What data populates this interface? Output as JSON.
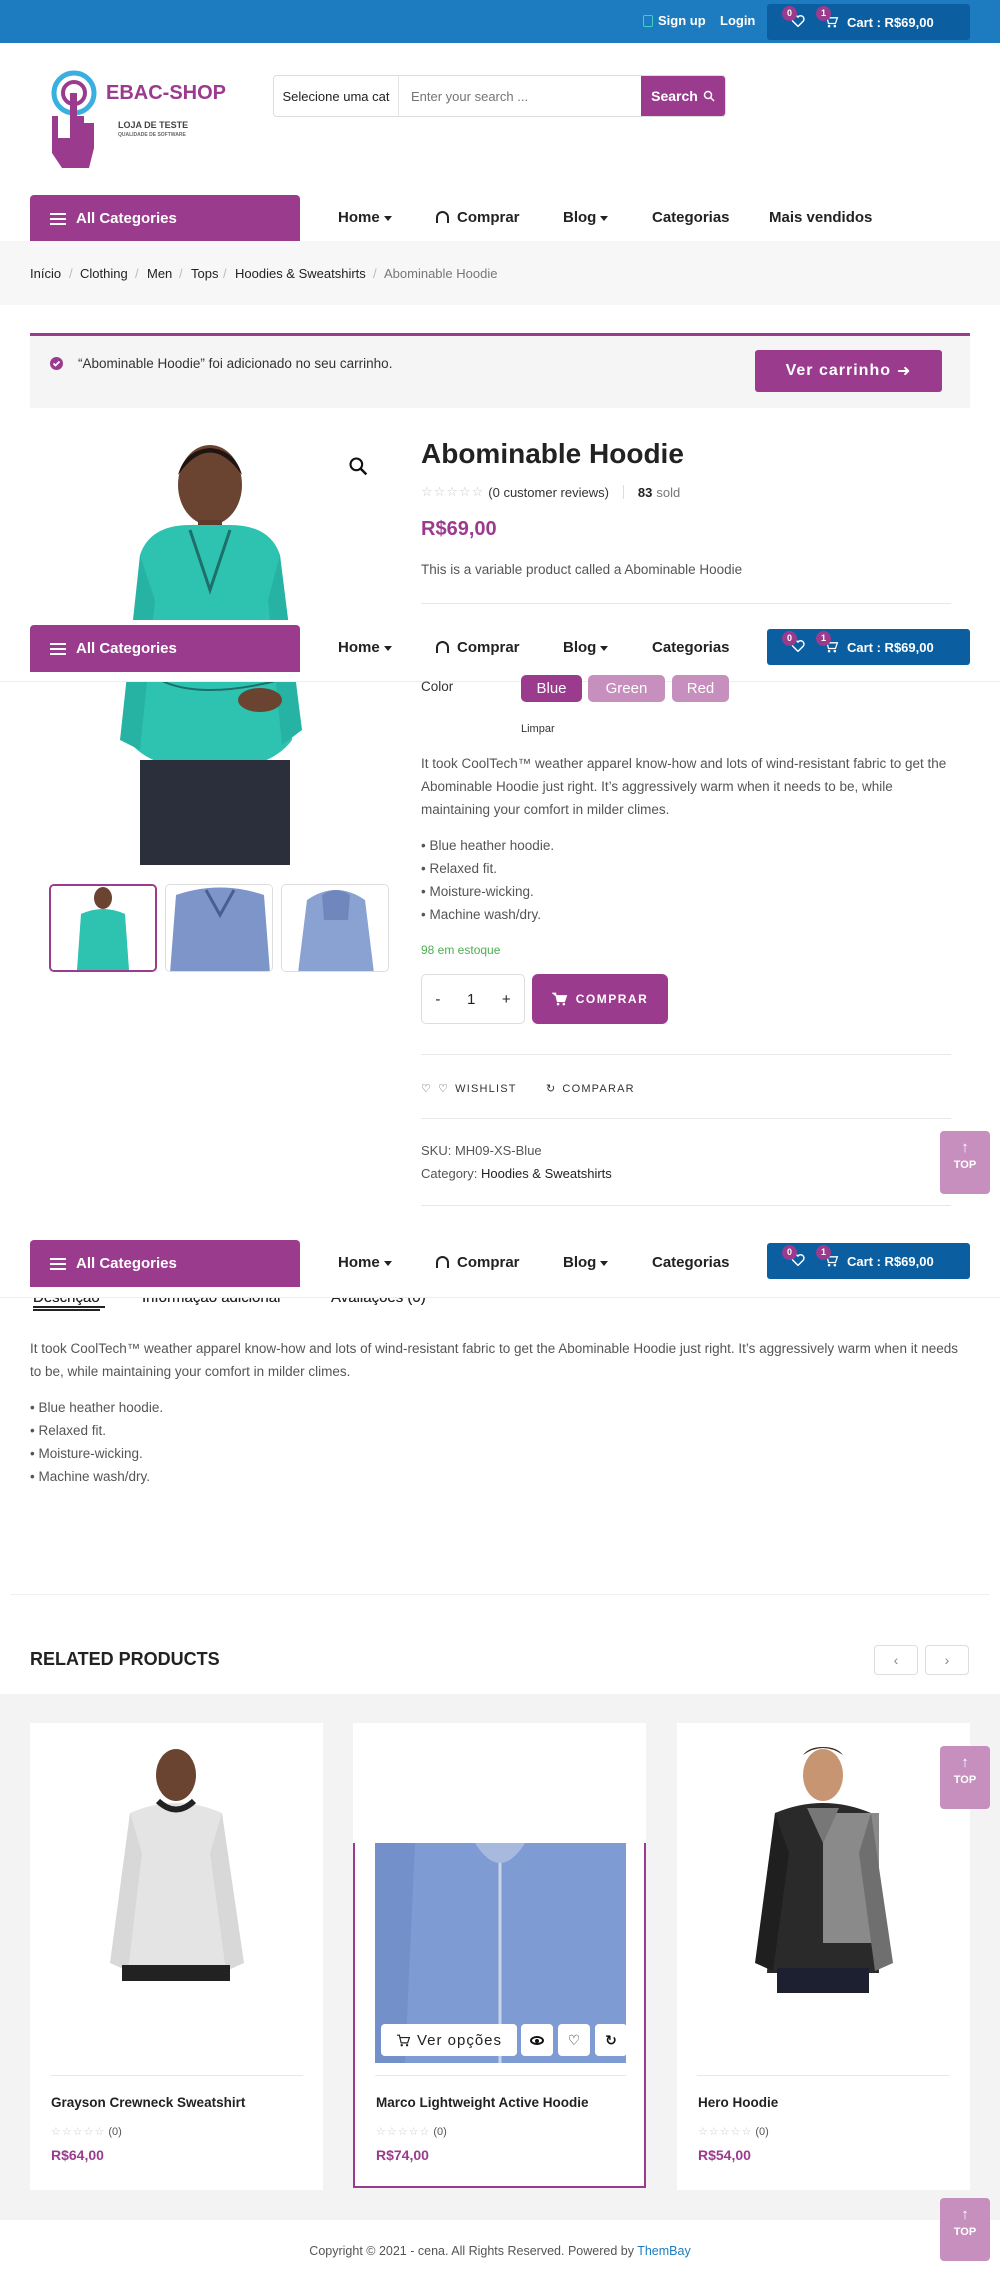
{
  "topbar": {
    "signup": "Sign up",
    "login": "Login",
    "wishlist_count": "0",
    "cart_count": "1",
    "cart_label": "Cart : R$69,00"
  },
  "logo": {
    "brand": "EBAC-SHOP",
    "tagline1": "LOJA DE TESTE",
    "tagline2": "QUALIDADE DE SOFTWARE"
  },
  "search": {
    "category": "Selecione uma cat",
    "placeholder": "Enter your search ...",
    "button": "Search"
  },
  "nav": {
    "all_categories": "All Categories",
    "items": [
      "Home",
      "Comprar",
      "Blog",
      "Categorias",
      "Mais vendidos"
    ]
  },
  "breadcrumb": [
    "Início",
    "Clothing",
    "Men",
    "Tops",
    "Hoodies & Sweatshirts",
    "Abominable Hoodie"
  ],
  "notice": {
    "text": "“Abominable Hoodie” foi adicionado no seu carrinho.",
    "button": "Ver carrinho"
  },
  "product": {
    "title": "Abominable Hoodie",
    "reviews": "(0 customer reviews)",
    "sold_count": "83",
    "sold_label": "sold",
    "price": "R$69,00",
    "short_desc": "This is a variable product called a Abominable Hoodie",
    "color_label": "Color",
    "colors": [
      "Blue",
      "Green",
      "Red"
    ],
    "clear": "Limpar",
    "long_desc": "It took CoolTech™ weather apparel know-how and lots of wind-resistant fabric to get the Abominable Hoodie just right. It’s aggressively warm when it needs to be, while maintaining your comfort in milder climes.",
    "bullets": [
      "• Blue heather hoodie.",
      "• Relaxed fit.",
      "• Moisture-wicking.",
      "• Machine wash/dry."
    ],
    "stock": "98 em estoque",
    "qty": "1",
    "minus": "-",
    "plus": "+",
    "buy": "COMPRAR",
    "wishlist": "WISHLIST",
    "compare": "COMPARAR",
    "sku": "SKU: MH09-XS-Blue",
    "category_label": "Category:",
    "category": "Hoodies & Sweatshirts"
  },
  "tabs": {
    "items": [
      "Descrição",
      "Informação adicional",
      "Avaliações (0)"
    ],
    "desc": "It took CoolTech™ weather apparel know-how and lots of wind-resistant fabric to get the Abominable Hoodie just right. It’s aggressively warm when it needs to be, while maintaining your comfort in milder climes.",
    "bullets": [
      "• Blue heather hoodie.",
      "• Relaxed fit.",
      "• Moisture-wicking.",
      "• Machine wash/dry."
    ]
  },
  "related": {
    "heading": "RELATED PRODUCTS",
    "view_options": "Ver opções",
    "items": [
      {
        "name": "Grayson Crewneck Sweatshirt",
        "reviews": "(0)",
        "price": "R$64,00"
      },
      {
        "name": "Marco Lightweight Active Hoodie",
        "reviews": "(0)",
        "price": "R$74,00"
      },
      {
        "name": "Hero Hoodie",
        "reviews": "(0)",
        "price": "R$54,00"
      }
    ]
  },
  "top_label": "TOP",
  "footer": {
    "copyright": "Copyright © 2021 - cena. All Rights Reserved. Powered by",
    "powered": "ThemBay"
  },
  "colors": {
    "primary": "#9b3b8e",
    "topbar": "#1d7cbf",
    "cart": "#0b5fa0",
    "stock": "#4caf50"
  }
}
